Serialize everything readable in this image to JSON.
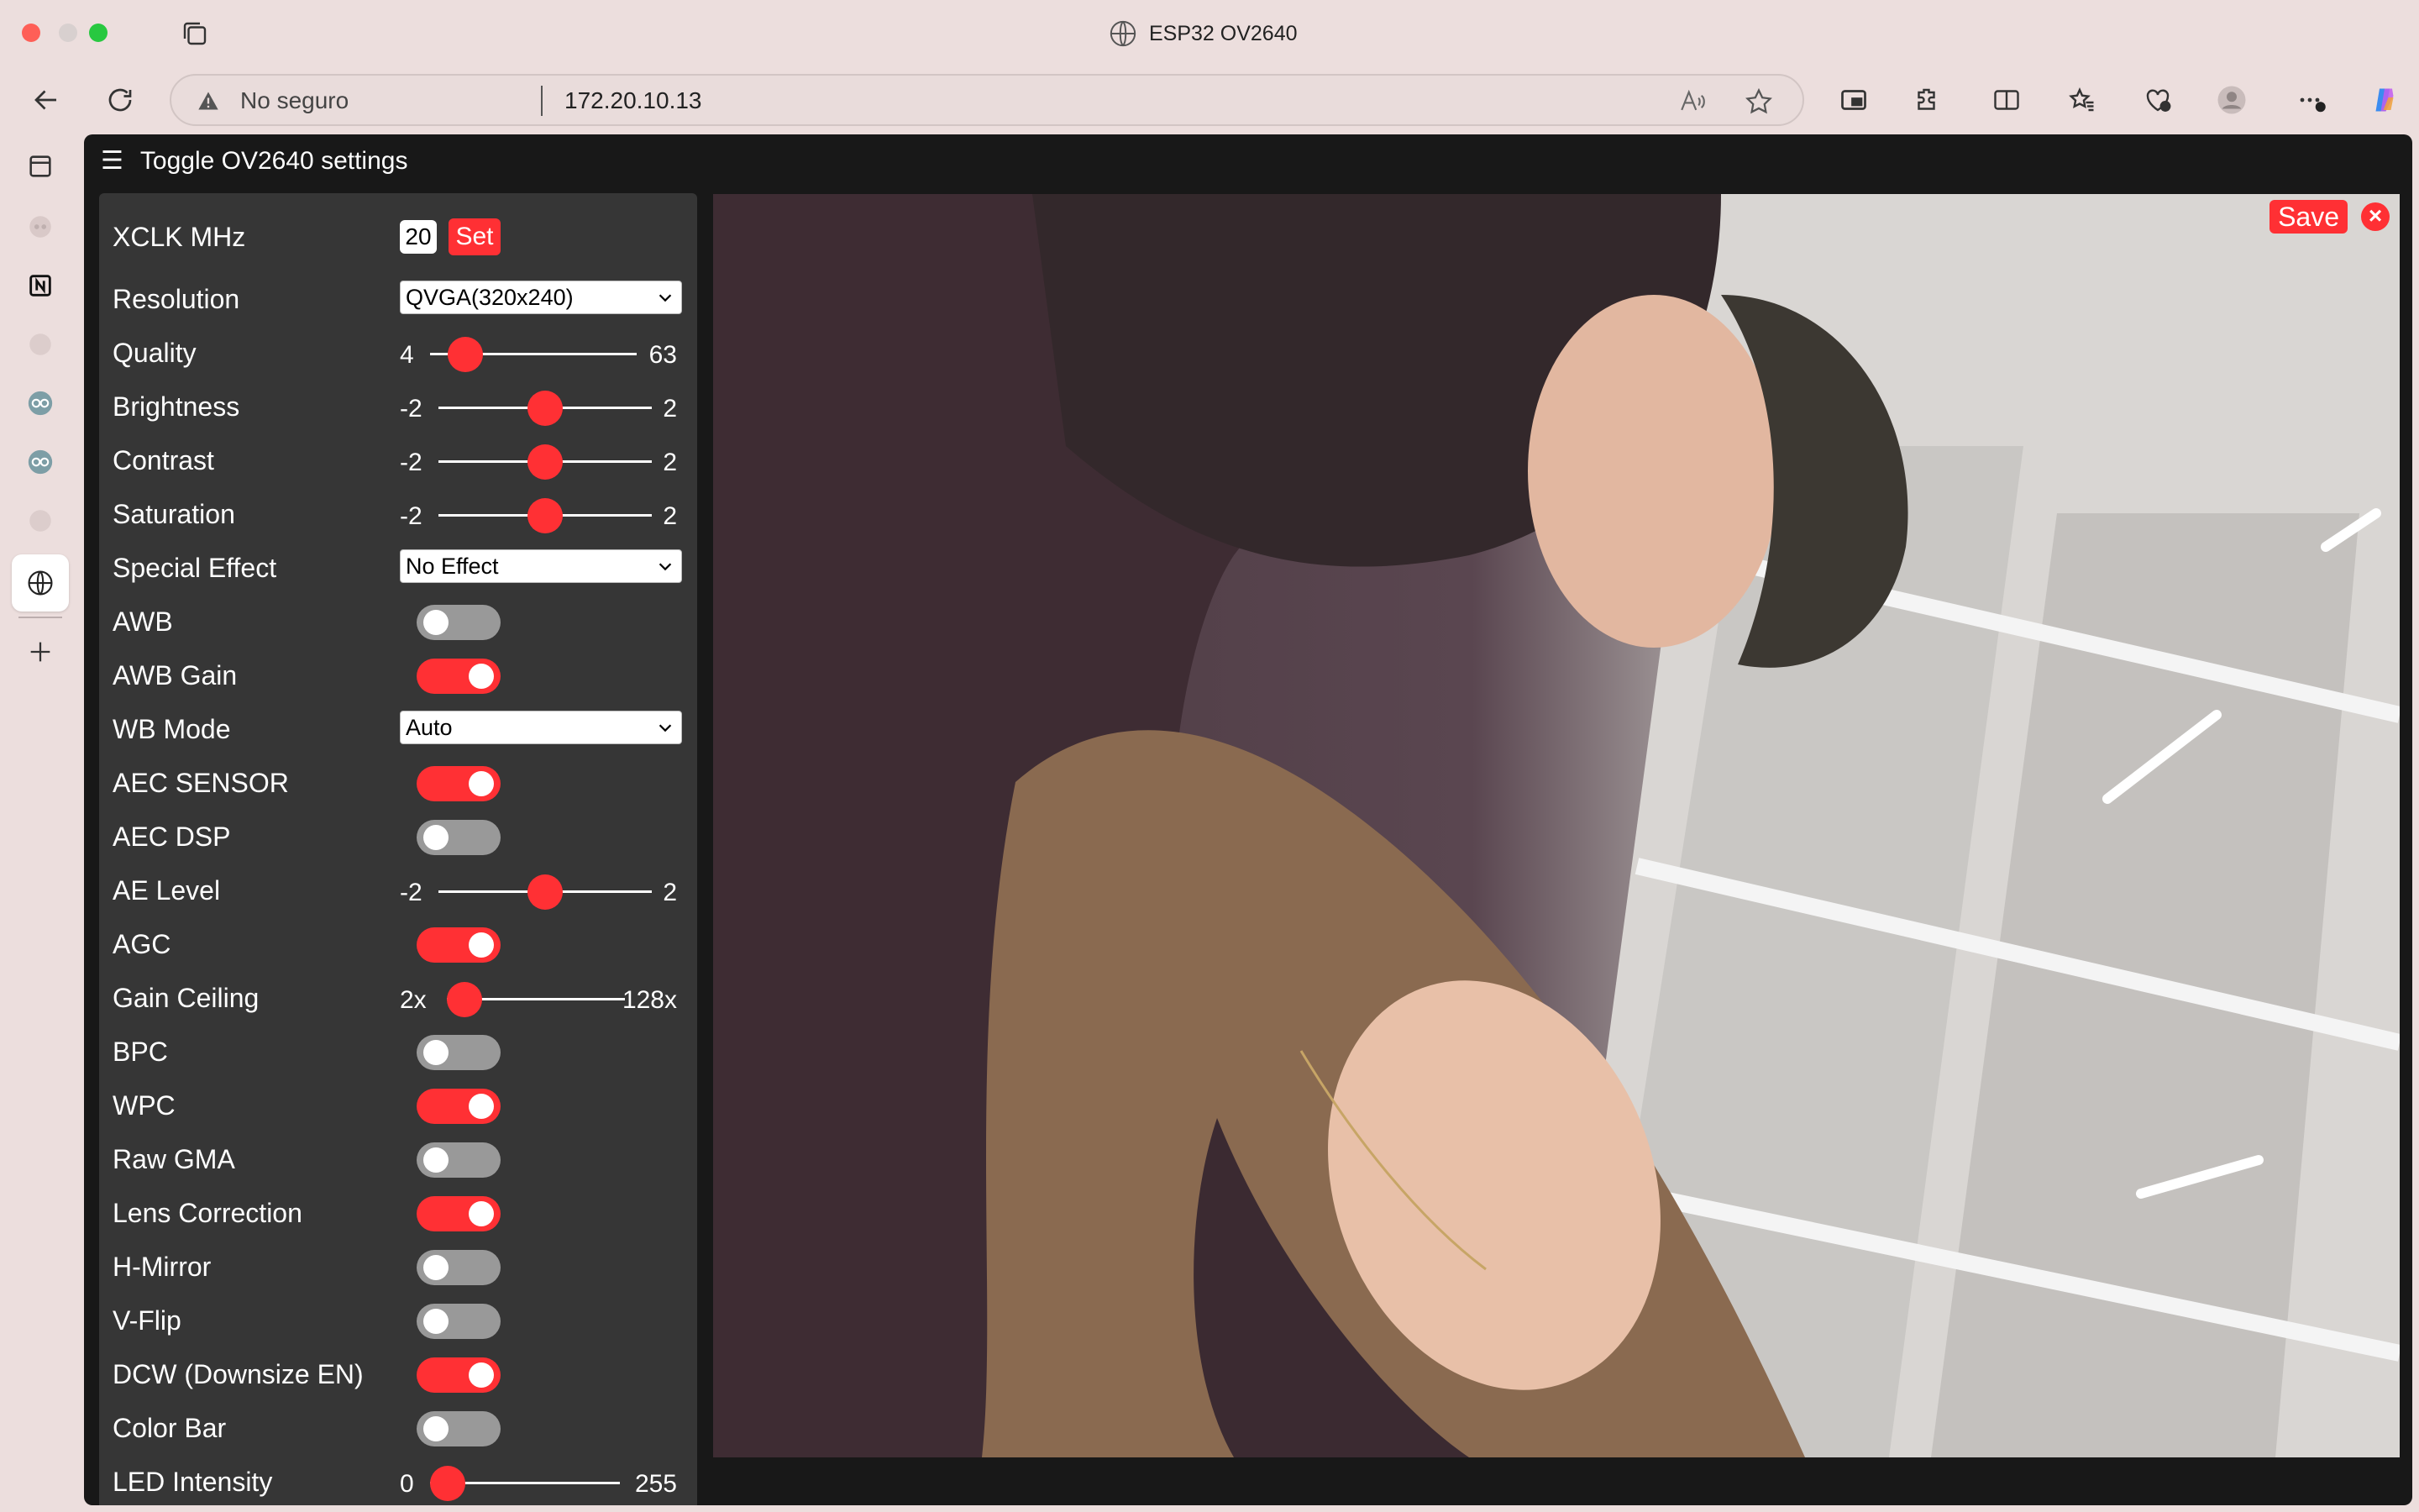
{
  "window": {
    "title": "ESP32 OV2640"
  },
  "address_bar": {
    "security_label": "No seguro",
    "url": "172.20.10.13"
  },
  "page": {
    "menu_toggle_label": "Toggle OV2640 settings",
    "xclk": {
      "label": "XCLK MHz",
      "value": "20",
      "button": "Set"
    },
    "resolution": {
      "label": "Resolution",
      "value": "QVGA(320x240)"
    },
    "quality": {
      "label": "Quality",
      "min": "4",
      "max": "63",
      "value": 10
    },
    "brightness": {
      "label": "Brightness",
      "min": "-2",
      "max": "2",
      "value": 0
    },
    "contrast": {
      "label": "Contrast",
      "min": "-2",
      "max": "2",
      "value": 0
    },
    "saturation": {
      "label": "Saturation",
      "min": "-2",
      "max": "2",
      "value": 0
    },
    "special_effect": {
      "label": "Special Effect",
      "value": "No Effect"
    },
    "awb": {
      "label": "AWB",
      "on": false
    },
    "awb_gain": {
      "label": "AWB Gain",
      "on": true
    },
    "wb_mode": {
      "label": "WB Mode",
      "value": "Auto"
    },
    "aec_sensor": {
      "label": "AEC SENSOR",
      "on": true
    },
    "aec_dsp": {
      "label": "AEC DSP",
      "on": false
    },
    "ae_level": {
      "label": "AE Level",
      "min": "-2",
      "max": "2",
      "value": 0
    },
    "agc": {
      "label": "AGC",
      "on": true
    },
    "gain_ceiling": {
      "label": "Gain Ceiling",
      "min": "2x",
      "max": "128x",
      "value": 0
    },
    "bpc": {
      "label": "BPC",
      "on": false
    },
    "wpc": {
      "label": "WPC",
      "on": true
    },
    "raw_gma": {
      "label": "Raw GMA",
      "on": false
    },
    "lens_correction": {
      "label": "Lens Correction",
      "on": true
    },
    "h_mirror": {
      "label": "H-Mirror",
      "on": false
    },
    "v_flip": {
      "label": "V-Flip",
      "on": false
    },
    "dcw": {
      "label": "DCW (Downsize EN)",
      "on": true
    },
    "color_bar": {
      "label": "Color Bar",
      "on": false
    },
    "led_intensity": {
      "label": "LED Intensity",
      "min": "0",
      "max": "255",
      "value": 0
    },
    "save_label": "Save",
    "close_label": "×"
  },
  "colors": {
    "accent": "#ff3034",
    "panel": "#363636",
    "background": "#181818"
  }
}
